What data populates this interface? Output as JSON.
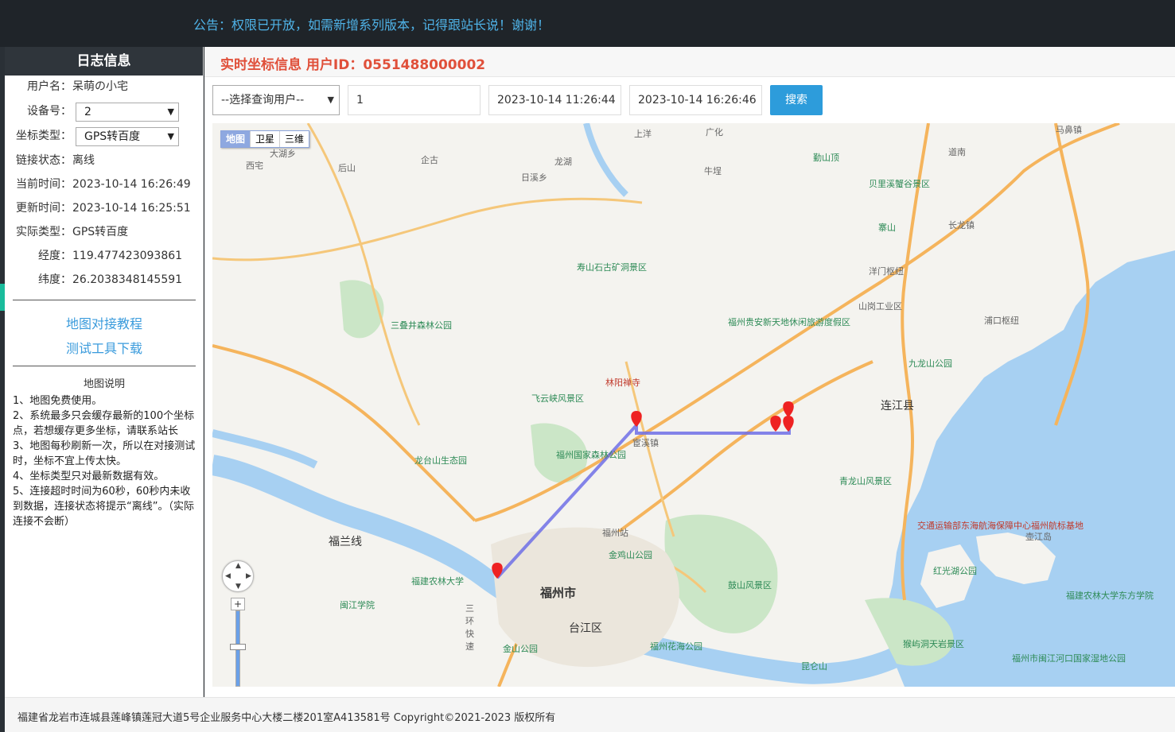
{
  "notice": "公告：权限已开放，如需新增系列版本，记得跟站长说！谢谢！",
  "sidebar": {
    "title": "日志信息",
    "username_label": "用户名：",
    "username": "呆萌の小宅",
    "device_label": "设备号：",
    "device_value": "2",
    "coord_type_label": "坐标类型：",
    "coord_type_value": "GPS转百度",
    "link_status_label": "链接状态：",
    "link_status": "离线",
    "current_time_label": "当前时间：",
    "current_time": "2023-10-14 16:26:49",
    "update_time_label": "更新时间：",
    "update_time": "2023-10-14 16:25:51",
    "actual_type_label": "实际类型：",
    "actual_type": "GPS转百度",
    "longitude_label": "经度：",
    "longitude": "119.477423093861",
    "latitude_label": "纬度：",
    "latitude": "26.2038348145591",
    "link_tutorial": "地图对接教程",
    "link_tool": "测试工具下载",
    "map_desc_title": "地图说明",
    "map_desc": [
      "1、地图免费使用。",
      "2、系统最多只会缓存最新的100个坐标点，若想缓存更多坐标，请联系站长",
      "3、地图每秒刷新一次，所以在对接测试时，坐标不宜上传太快。",
      "4、坐标类型只对最新数据有效。",
      "5、连接超时时间为60秒，60秒内未收到数据，连接状态将提示“离线”。（实际连接不会断）"
    ]
  },
  "main": {
    "title": "实时坐标信息  用户ID：0551488000002",
    "user_select": "--选择查询用户--",
    "input_value": "1",
    "start_time": "2023-10-14 11:26:44",
    "end_time": "2023-10-14 16:26:46",
    "search_label": "搜索"
  },
  "map": {
    "type_buttons": [
      "地图",
      "卫星",
      "三维"
    ],
    "labels": {
      "city": "福州市",
      "county": "连江县",
      "district": "台江区",
      "shanglan": "上洋",
      "guanghua": "广化",
      "dahu": "大湖乡",
      "xizhai": "西宅",
      "houshan": "后山",
      "qigu": "企古",
      "longhu": "龙湖",
      "rixi": "日溪乡",
      "niudi": "牛埕",
      "qinshan": "勤山顶",
      "beili": "贝里溪蟹谷景区",
      "lianshan": "寨山",
      "changlong": "长龙镇",
      "yangmen": "洋门枢纽",
      "shanggang": "山岗工业区",
      "puhou": "浦口枢纽",
      "jiulong": "九龙山公园",
      "shoushan": "寿山石古矿洞景区",
      "sanfeng": "三叠井森林公园",
      "linyang": "林阳禅寺",
      "feiyun": "飞云峡风景区",
      "guojia": "福州国家森林公园",
      "longtai": "龙台山生态园",
      "rixiang": "宦溪镇",
      "guixin": "福州贵安新天地休闲旅游度假区",
      "qinglong": "青龙山风景区",
      "jiaotong": "交通运输部东海航海保障中心福州航标基地",
      "hongguang": "红光湖公园",
      "nongmu": "福建农林大学东方学院",
      "jinjiqu": "金鸡山公园",
      "gushan": "鼓山风景区",
      "huahai": "福州花海公园",
      "station": "福州站",
      "minjiang": "闽江学院",
      "nonglin": "福建农林大学",
      "huanhuan": "三环快速",
      "fulan": "福兰线",
      "jinshan": "金山公园",
      "houyu": "猴屿洞天岩景区",
      "wetland": "福州市闽江河口国家湿地公园",
      "kunlun": "昆仑山",
      "pailou": "壶江岛",
      "mayun": "马鼻镇",
      "daoNan": "道南"
    }
  },
  "footer": "福建省龙岩市连城县莲峰镇莲冠大道5号企业服务中心大楼二楼201室A413581号 Copyright©2021-2023 版权所有"
}
